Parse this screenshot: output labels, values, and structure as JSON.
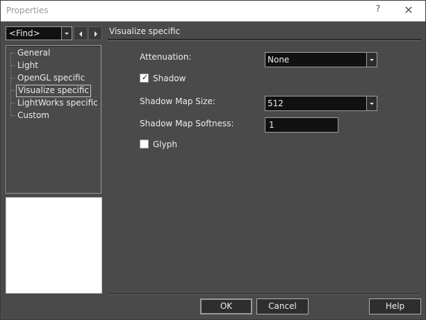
{
  "window": {
    "title": "Properties",
    "help_glyph": "?",
    "close_glyph": "✕"
  },
  "find": {
    "value": "<Find>"
  },
  "tree": {
    "items": [
      {
        "label": "General",
        "selected": false
      },
      {
        "label": "Light",
        "selected": false
      },
      {
        "label": "OpenGL specific",
        "selected": false
      },
      {
        "label": "Visualize specific",
        "selected": true
      },
      {
        "label": "LightWorks specific",
        "selected": false
      },
      {
        "label": "Custom",
        "selected": false
      }
    ]
  },
  "section": {
    "title": "Visualize specific"
  },
  "fields": {
    "attenuation": {
      "label": "Attenuation:",
      "value": "None"
    },
    "shadow": {
      "label": "Shadow",
      "checked": true
    },
    "shadow_map_size": {
      "label": "Shadow Map Size:",
      "value": "512"
    },
    "shadow_map_softness": {
      "label": "Shadow Map Softness:",
      "value": "1"
    },
    "glyph": {
      "label": "Glyph",
      "checked": false
    }
  },
  "buttons": {
    "ok": "OK",
    "cancel": "Cancel",
    "help": "Help"
  }
}
